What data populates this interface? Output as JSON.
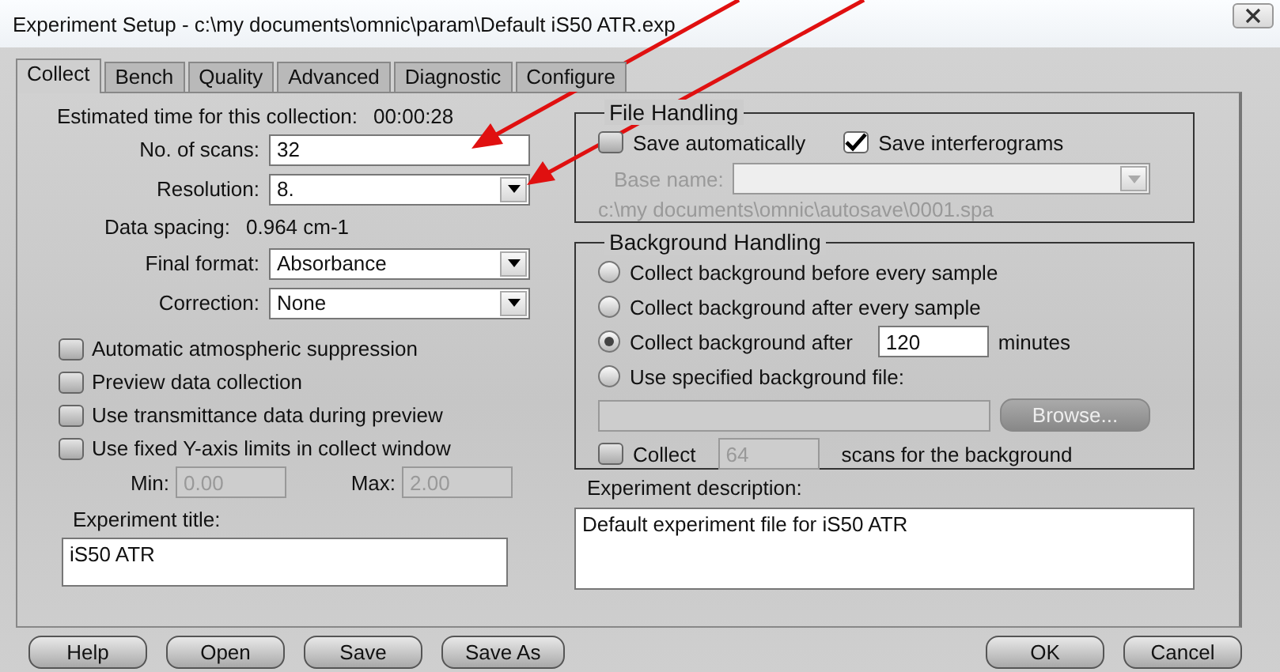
{
  "window": {
    "title": "Experiment Setup - c:\\my documents\\omnic\\param\\Default iS50 ATR.exp"
  },
  "tabs": [
    {
      "label": "Collect",
      "selected": true
    },
    {
      "label": "Bench",
      "selected": false
    },
    {
      "label": "Quality",
      "selected": false
    },
    {
      "label": "Advanced",
      "selected": false
    },
    {
      "label": "Diagnostic",
      "selected": false
    },
    {
      "label": "Configure",
      "selected": false
    }
  ],
  "estimated_time": {
    "label": "Estimated time for this collection:",
    "value": "00:00:28"
  },
  "fields": [
    {
      "kind": "text",
      "label": "No. of scans:",
      "value": "32"
    },
    {
      "kind": "dropdown",
      "label": "Resolution:",
      "value": "8."
    },
    {
      "kind": "readout",
      "label": "Data spacing:",
      "value": "0.964 cm-1"
    },
    {
      "kind": "dropdown",
      "label": "Final format:",
      "value": "Absorbance"
    },
    {
      "kind": "dropdown",
      "label": "Correction:",
      "value": "None"
    }
  ],
  "options": [
    {
      "label": "Automatic atmospheric suppression",
      "checked": false
    },
    {
      "label": "Preview data collection",
      "checked": false
    },
    {
      "label": "Use transmittance data during preview",
      "checked": false
    },
    {
      "label": "Use fixed Y-axis limits in collect window",
      "checked": false
    }
  ],
  "y_limits": [
    {
      "label": "Min:",
      "value": "0.00",
      "disabled": true
    },
    {
      "label": "Max:",
      "value": "2.00",
      "disabled": true
    }
  ],
  "experiment_title": {
    "label": "Experiment title:",
    "value": "iS50 ATR"
  },
  "file_handling": {
    "title": "File Handling",
    "checks": [
      {
        "label": "Save automatically",
        "checked": false
      },
      {
        "label": "Save interferograms",
        "checked": true
      }
    ],
    "base_name": {
      "label": "Base name:",
      "disabled": true
    },
    "path": "c:\\my documents\\omnic\\autosave\\0001.spa"
  },
  "background_handling": {
    "title": "Background Handling",
    "options": [
      {
        "kind": "plain",
        "label": "Collect background before every sample",
        "selected": false
      },
      {
        "kind": "plain",
        "label": "Collect background after every sample",
        "selected": false
      },
      {
        "kind": "interval",
        "label": "Collect background after",
        "value": "120",
        "unit": "minutes",
        "selected": true
      },
      {
        "kind": "file",
        "label": "Use specified background file:",
        "selected": false,
        "browse": "Browse...",
        "disabled": true
      }
    ],
    "collect": {
      "label": "Collect",
      "checked": false,
      "value": "64",
      "disabled": true,
      "suffix": "scans for the background"
    }
  },
  "experiment_description": {
    "label": "Experiment description:",
    "value": "Default experiment file for iS50 ATR"
  },
  "buttons": {
    "left": [
      {
        "label": "Help"
      },
      {
        "label": "Open"
      },
      {
        "label": "Save"
      },
      {
        "label": "Save As"
      }
    ],
    "right": [
      {
        "label": "OK"
      },
      {
        "label": "Cancel"
      }
    ]
  }
}
